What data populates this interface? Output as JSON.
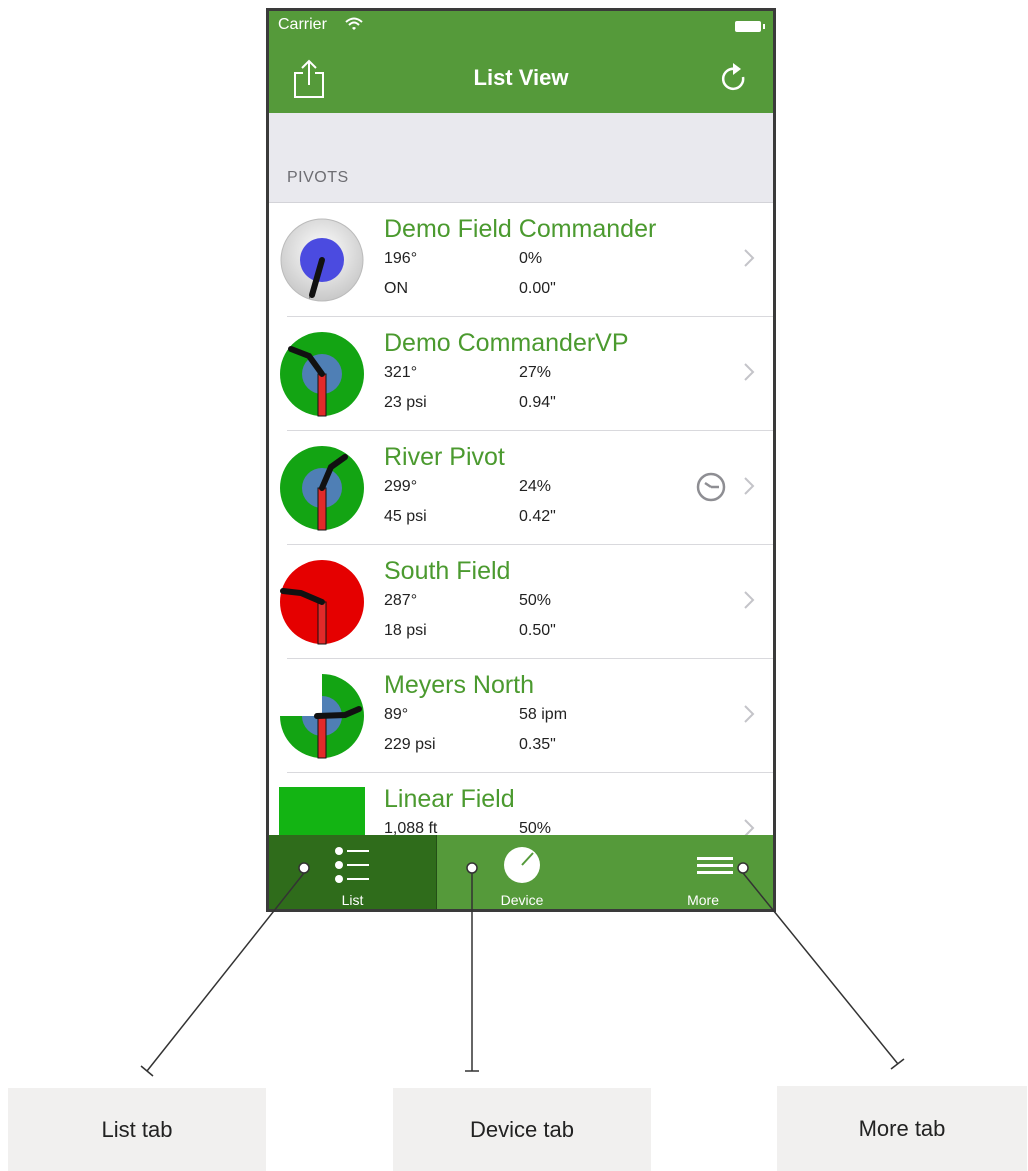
{
  "status_bar": {
    "carrier": "Carrier"
  },
  "nav": {
    "title": "List View",
    "share_icon": "share-icon",
    "refresh_icon": "refresh-icon"
  },
  "section": {
    "title": "PIVOTS"
  },
  "pivots": [
    {
      "name": "Demo Field Commander",
      "angle": "196°",
      "percent": "0%",
      "status": "ON",
      "depth": "0.00\""
    },
    {
      "name": "Demo CommanderVP",
      "angle": "321°",
      "percent": "27%",
      "status": "23 psi",
      "depth": "0.94\""
    },
    {
      "name": "River Pivot",
      "angle": "299°",
      "percent": "24%",
      "status": "45 psi",
      "depth": "0.42\""
    },
    {
      "name": "South Field",
      "angle": "287°",
      "percent": "50%",
      "status": "18 psi",
      "depth": "0.50\""
    },
    {
      "name": "Meyers North",
      "angle": "89°",
      "percent": "58 ipm",
      "status": "229 psi",
      "depth": "0.35\""
    },
    {
      "name": "Linear Field",
      "angle": "1,088 ft",
      "percent": "50%",
      "status": "",
      "depth": ""
    }
  ],
  "tabs": {
    "list": "List",
    "device": "Device",
    "more": "More"
  },
  "callouts": {
    "list": "List tab",
    "device": "Device tab",
    "more": "More tab"
  },
  "colors": {
    "brand_green": "#559a3a",
    "active_tab": "#2f6c1b",
    "name_green": "#4b9a2f"
  }
}
